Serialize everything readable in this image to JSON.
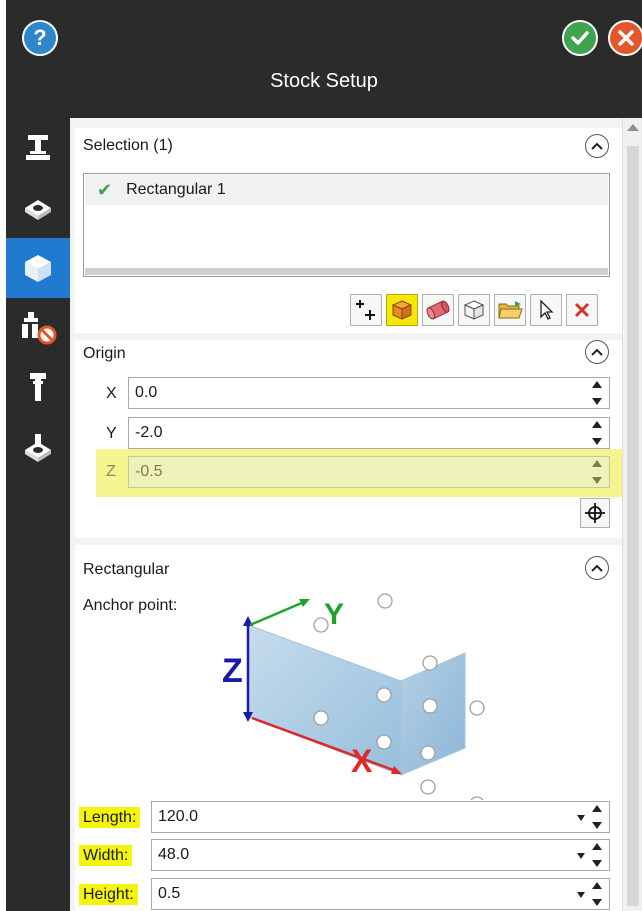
{
  "header": {
    "title": "Stock Setup",
    "help_icon": "question-icon",
    "ok_icon": "check-icon",
    "close_icon": "close-icon"
  },
  "sidebar": {
    "items": [
      {
        "name": "machine-setup-icon",
        "active": false
      },
      {
        "name": "part-setup-icon",
        "active": false
      },
      {
        "name": "stock-setup-icon",
        "active": true
      },
      {
        "name": "fixture-avoid-icon",
        "active": false
      },
      {
        "name": "tool-icon",
        "active": false
      },
      {
        "name": "stock-cut-icon",
        "active": false
      }
    ]
  },
  "selection": {
    "title": "Selection (1)",
    "items": [
      {
        "label": "Rectangular 1",
        "icon": "check-icon"
      }
    ],
    "toolbar": [
      "add-stock-icon",
      "box-stock-icon",
      "cylinder-stock-icon",
      "wireframe-box-icon",
      "open-folder-icon",
      "select-cursor-icon",
      "delete-icon"
    ]
  },
  "origin": {
    "title": "Origin",
    "x_label": "X",
    "x_value": "0.0",
    "y_label": "Y",
    "y_value": "-2.0",
    "z_label": "Z",
    "z_value": "-0.5"
  },
  "rectangular": {
    "title": "Rectangular",
    "anchor_label": "Anchor point:",
    "axis_x": "X",
    "axis_y": "Y",
    "axis_z": "Z",
    "length_label": "Length:",
    "length_value": "120.0",
    "width_label": "Width:",
    "width_value": "48.0",
    "height_label": "Height:",
    "height_value": "0.5"
  },
  "colors": {
    "accent": "#1f7ad0",
    "highlight": "#f4f50b",
    "dark": "#2b2b2b",
    "ok": "#3fa44d",
    "cancel": "#e3572d"
  }
}
